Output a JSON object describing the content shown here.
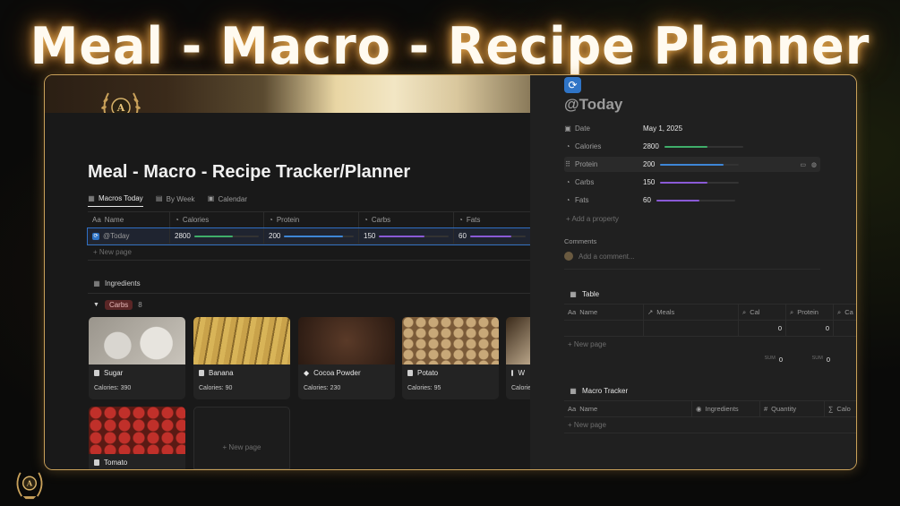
{
  "headline": "Meal - Macro - Recipe Planner",
  "colors": {
    "green": "#3fae6a",
    "blue": "#3e86d6",
    "purple": "#8a5ad6",
    "accent_gold": "#c9a15a"
  },
  "left": {
    "page_title": "Meal - Macro - Recipe Tracker/Planner",
    "tabs": [
      {
        "label": "Macros Today",
        "icon": "table-icon",
        "active": true
      },
      {
        "label": "By Week",
        "icon": "gallery-icon",
        "active": false
      },
      {
        "label": "Calendar",
        "icon": "calendar-icon",
        "active": false
      }
    ],
    "table": {
      "headers": [
        {
          "label": "Name",
          "icon": "Aa"
        },
        {
          "label": "Calories",
          "icon": "◔"
        },
        {
          "label": "Protein",
          "icon": "◔"
        },
        {
          "label": "Carbs",
          "icon": "◔"
        },
        {
          "label": "Fats",
          "icon": "◔"
        }
      ],
      "row": {
        "name": "@Today",
        "calories": "2800",
        "protein": "200",
        "carbs": "150",
        "fats": "60",
        "calories_pct": 0.6,
        "protein_pct": 0.85,
        "carbs_pct": 0.65,
        "fats_pct": 0.75
      },
      "new_page": "+ New page"
    },
    "ingredients": {
      "title": "Ingredients",
      "group_label": "Carbs",
      "group_count": "8",
      "cards": [
        {
          "name": "Sugar",
          "calories": "Calories: 390"
        },
        {
          "name": "Banana",
          "calories": "Calories: 90"
        },
        {
          "name": "Cocoa Powder",
          "calories": "Calories: 230"
        },
        {
          "name": "Potato",
          "calories": "Calories: 95"
        },
        {
          "name": "W",
          "calories": "Calorie"
        },
        {
          "name": "Tomato",
          "calories": ""
        }
      ],
      "new_page": "+ New page"
    }
  },
  "right": {
    "title": "@Today",
    "props": [
      {
        "key": "Date",
        "value": "May 1, 2025"
      },
      {
        "key": "Calories",
        "value": "2800",
        "pct": 0.55,
        "color": "green"
      },
      {
        "key": "Protein",
        "value": "200",
        "pct": 0.8,
        "color": "blue"
      },
      {
        "key": "Carbs",
        "value": "150",
        "pct": 0.6,
        "color": "purple"
      },
      {
        "key": "Fats",
        "value": "60",
        "pct": 0.55,
        "color": "purple"
      }
    ],
    "add_property": "+ Add a property",
    "comments_label": "Comments",
    "comment_placeholder": "Add a comment...",
    "table": {
      "title": "Table",
      "headers": [
        "Name",
        "Meals",
        "Cal",
        "Protein",
        "Ca"
      ],
      "row": [
        "",
        "",
        "0",
        "0",
        ""
      ],
      "new_page": "+ New page",
      "sum_label": "SUM",
      "sum_values": [
        "0",
        "0"
      ]
    },
    "macro_tracker": {
      "title": "Macro Tracker",
      "headers": [
        "Name",
        "Ingredients",
        "Quantity",
        "Calo"
      ],
      "new_page": "+ New page"
    }
  }
}
